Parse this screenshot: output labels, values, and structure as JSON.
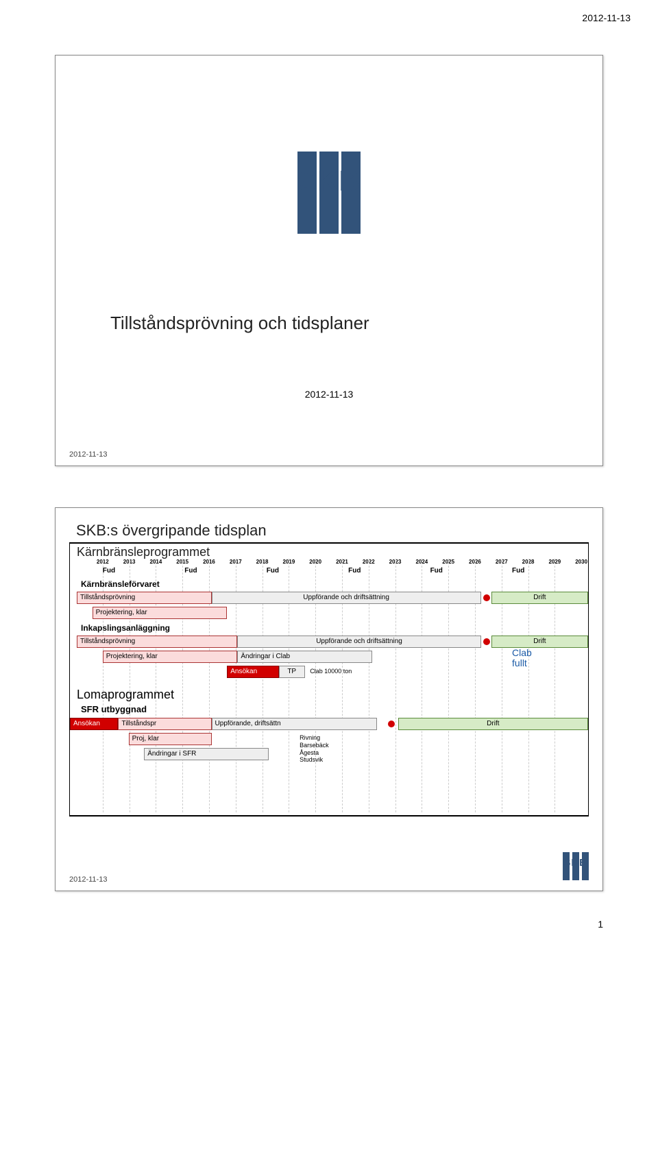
{
  "page": {
    "header_date": "2012-11-13",
    "page_number": "1"
  },
  "slide1": {
    "logo_text": "SKB",
    "title": "Tillståndsprövning och tidsplaner",
    "date": "2012-11-13",
    "footer": "2012-11-13"
  },
  "slide2": {
    "title": "SKB:s övergripande tidsplan",
    "section1": "Kärnbränsleprogrammet",
    "fud": "Fud",
    "sub1": "Kärnbränsleförvaret",
    "bar_tp": "Tillståndsprövning",
    "bar_uppf": "Uppförande och driftsättning",
    "bar_drift": "Drift",
    "bar_proj": "Projektering, klar",
    "sub2": "Inkapslingsanläggning",
    "bar_andr_clab": "Ändringar i Clab",
    "bar_ansokan": "Ansökan",
    "bar_tp_short": "TP",
    "clab_10000": "Clab 10000 ton",
    "clab_fullt": "Clab\nfullt",
    "section2": "Lomaprogrammet",
    "sub3": "SFR utbyggnad",
    "bar_tillstandspr": "Tillståndspr",
    "bar_uppf2": "Uppförande, driftsättn",
    "bar_proj2": "Proj, klar",
    "bar_andr_sfr": "Ändringar i SFR",
    "rivning": "Rivning\nBarsebäck\nÅgesta\nStudsvik",
    "footer": "2012-11-13"
  },
  "chart_data": {
    "type": "gantt",
    "title": "SKB:s övergripande tidsplan",
    "x_axis": {
      "label": "",
      "range": [
        2012,
        2030
      ],
      "ticks": [
        2012,
        2013,
        2014,
        2015,
        2016,
        2017,
        2018,
        2019,
        2020,
        2021,
        2022,
        2023,
        2024,
        2025,
        2026,
        2027,
        2028,
        2029,
        2030
      ]
    },
    "fud_markers": [
      2013,
      2016,
      2019,
      2022,
      2025,
      2028
    ],
    "groups": [
      {
        "name": "Kärnbränsleprogrammet",
        "subgroups": [
          {
            "name": "Kärnbränsleförvaret",
            "tasks": [
              {
                "label": "Tillståndsprövning",
                "start": 2012,
                "end": 2017,
                "color": "pink"
              },
              {
                "label": "Uppförande och driftsättning",
                "start": 2017,
                "end": 2027,
                "color": "gray"
              },
              {
                "label": "Drift",
                "start": 2027,
                "end": 2030,
                "color": "green",
                "milestone_at": 2027
              },
              {
                "label": "Projektering, klar",
                "start": 2012.5,
                "end": 2017.5,
                "color": "pink"
              }
            ]
          },
          {
            "name": "Inkapslingsanläggning",
            "tasks": [
              {
                "label": "Tillståndsprövning",
                "start": 2012,
                "end": 2018,
                "color": "pink"
              },
              {
                "label": "Uppförande och driftsättning",
                "start": 2018,
                "end": 2027,
                "color": "gray"
              },
              {
                "label": "Drift",
                "start": 2027,
                "end": 2030,
                "color": "green",
                "milestone_at": 2027
              },
              {
                "label": "Projektering, klar",
                "start": 2013,
                "end": 2018,
                "color": "pink"
              },
              {
                "label": "Ändringar i Clab",
                "start": 2018,
                "end": 2023,
                "color": "gray"
              },
              {
                "label": "Ansökan",
                "start": 2017.5,
                "end": 2019.5,
                "color": "red"
              },
              {
                "label": "TP",
                "start": 2019.5,
                "end": 2020.5,
                "color": "gray"
              },
              {
                "label": "Clab 10000 ton",
                "start": 2020.5,
                "end": 2023,
                "note": true
              },
              {
                "label": "Clab fullt",
                "start": 2028,
                "end": 2030,
                "color": "text"
              }
            ]
          }
        ]
      },
      {
        "name": "Lomaprogrammet",
        "subgroups": [
          {
            "name": "SFR utbyggnad",
            "tasks": [
              {
                "label": "Ansökan",
                "start": 2012,
                "end": 2013.5,
                "color": "red"
              },
              {
                "label": "Tillståndspr",
                "start": 2013.5,
                "end": 2017,
                "color": "pink"
              },
              {
                "label": "Uppförande, driftsättn",
                "start": 2017,
                "end": 2023,
                "color": "gray"
              },
              {
                "label": "Drift",
                "start": 2023.5,
                "end": 2030,
                "color": "green",
                "milestone_at": 2023.5
              },
              {
                "label": "Proj, klar",
                "start": 2014,
                "end": 2017,
                "color": "pink"
              },
              {
                "label": "Ändringar i SFR",
                "start": 2014.5,
                "end": 2019,
                "color": "gray"
              },
              {
                "label": "Rivning Barsebäck Ågesta Studsvik",
                "start": 2020,
                "end": 2023,
                "note": true
              }
            ]
          }
        ]
      }
    ]
  }
}
